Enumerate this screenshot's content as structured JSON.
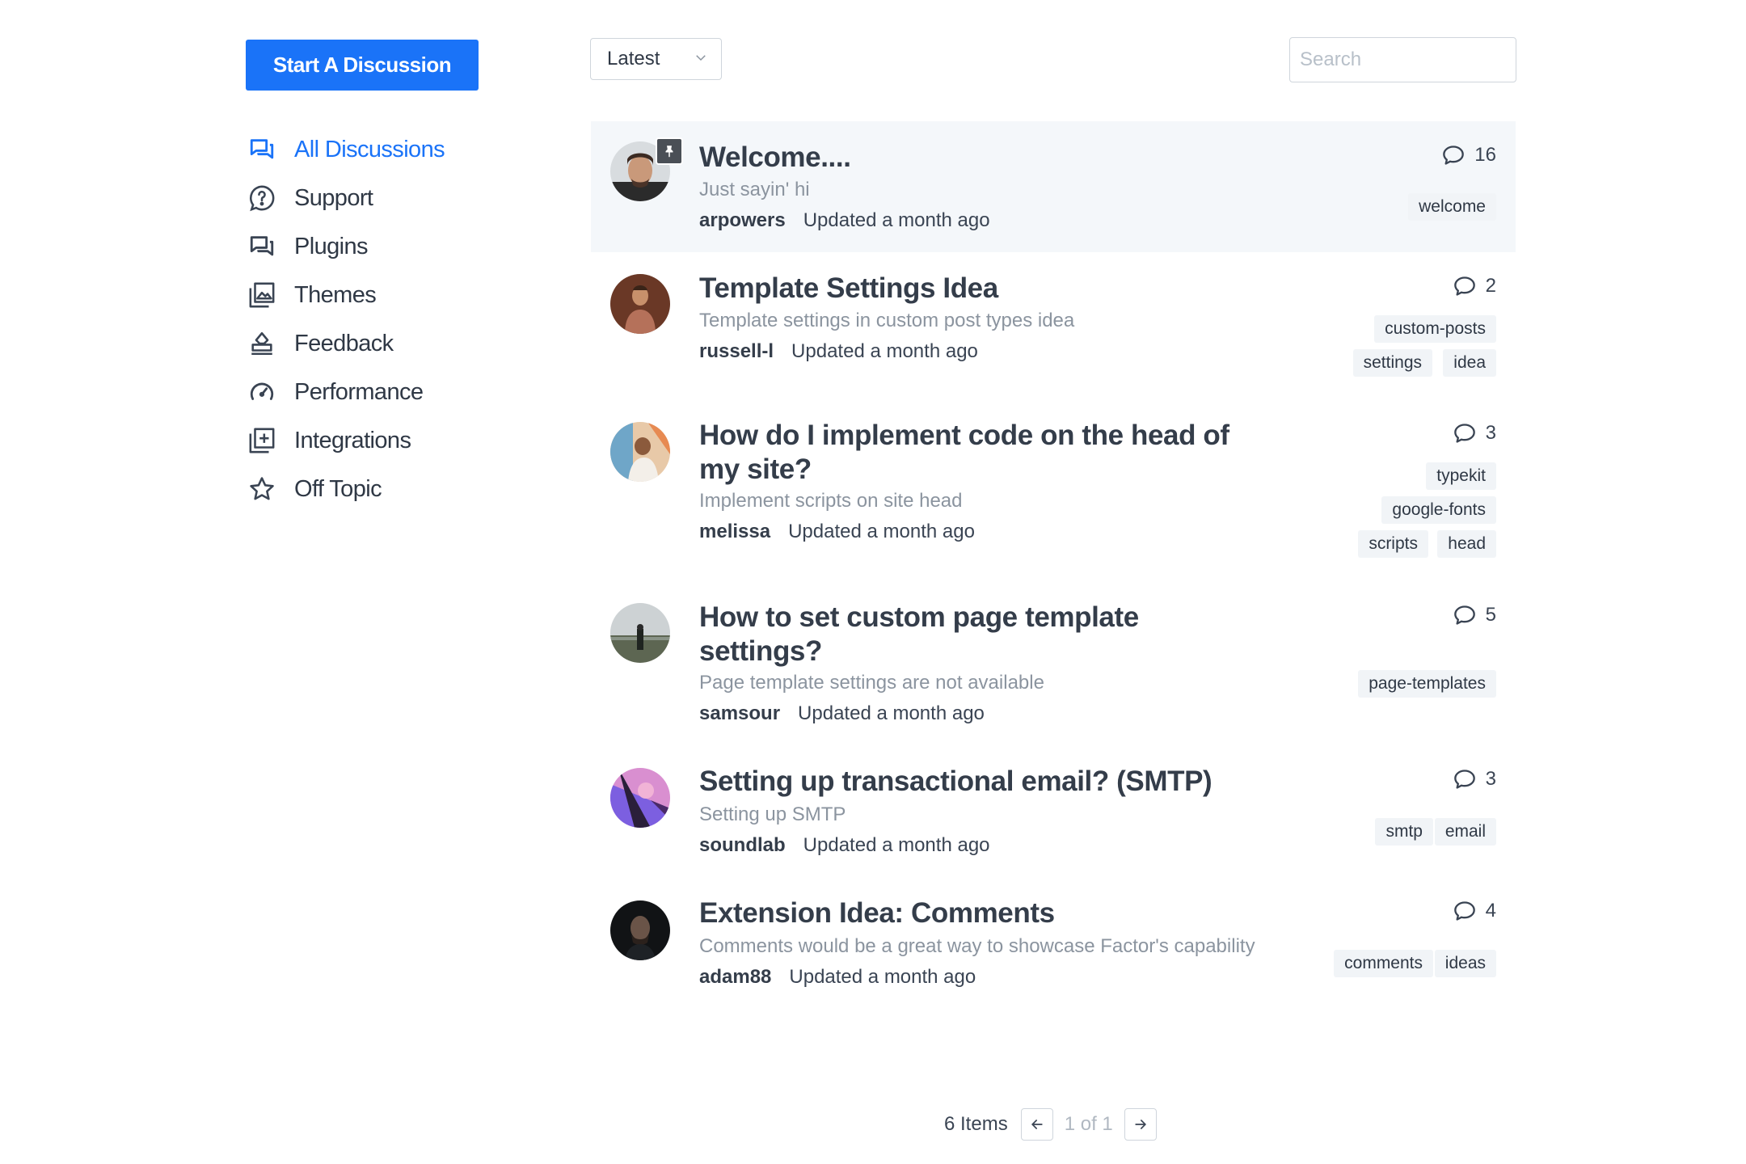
{
  "actions": {
    "start_label": "Start A Discussion"
  },
  "sidebar": {
    "items": [
      {
        "label": "All Discussions",
        "icon": "discussions-icon",
        "active": true
      },
      {
        "label": "Support",
        "icon": "question-circle-icon"
      },
      {
        "label": "Plugins",
        "icon": "chat-bubbles-icon"
      },
      {
        "label": "Themes",
        "icon": "image-gallery-icon"
      },
      {
        "label": "Feedback",
        "icon": "stamp-icon"
      },
      {
        "label": "Performance",
        "icon": "gauge-icon"
      },
      {
        "label": "Integrations",
        "icon": "add-square-icon"
      },
      {
        "label": "Off Topic",
        "icon": "star-icon"
      }
    ]
  },
  "toolbar": {
    "sort_value": "Latest",
    "search_placeholder": "Search"
  },
  "posts": [
    {
      "title": "Welcome....",
      "subtitle": "Just sayin' hi",
      "author": "arpowers",
      "updated": "Updated a month ago",
      "count": "16",
      "tags": [
        "welcome"
      ],
      "pinned": true
    },
    {
      "title": "Template Settings Idea",
      "subtitle": "Template settings in custom post types idea",
      "author": "russell-l",
      "updated": "Updated a month ago",
      "count": "2",
      "tags": [
        "custom-posts",
        "settings",
        "idea"
      ]
    },
    {
      "title": "How do I implement code on the head of my site?",
      "subtitle": "Implement scripts on site head",
      "author": "melissa",
      "updated": "Updated a month ago",
      "count": "3",
      "tags": [
        "typekit",
        "google-fonts",
        "scripts",
        "head"
      ]
    },
    {
      "title": "How to set custom page template settings?",
      "subtitle": "Page template settings are not available",
      "author": "samsour",
      "updated": "Updated a month ago",
      "count": "5",
      "tags": [
        "page-templates"
      ]
    },
    {
      "title": "Setting up transactional email? (SMTP)",
      "subtitle": "Setting up SMTP",
      "author": "soundlab",
      "updated": "Updated a month ago",
      "count": "3",
      "tags": [
        "smtp",
        "email"
      ]
    },
    {
      "title": "Extension Idea: Comments",
      "subtitle": "Comments would be a great way to showcase Factor's capability",
      "author": "adam88",
      "updated": "Updated a month ago",
      "count": "4",
      "tags": [
        "comments",
        "ideas"
      ]
    }
  ],
  "pagination": {
    "items_label": "6 Items",
    "page_label": "1 of 1"
  },
  "colors": {
    "accent": "#1a73f8",
    "highlight_bg": "#f4f7fa",
    "tag_bg": "#f1f4f7",
    "text": "#3a4453",
    "muted": "#8b949f"
  }
}
